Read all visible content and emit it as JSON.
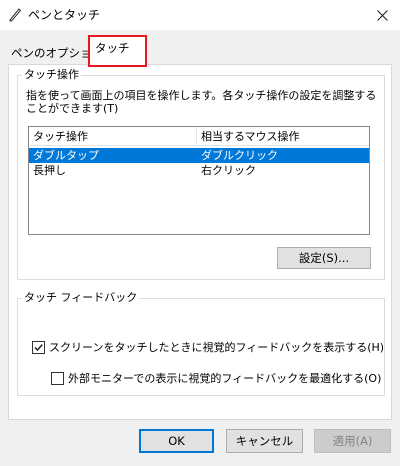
{
  "window": {
    "title": "ペンとタッチ",
    "icon": "pen-icon",
    "close_glyph": "×"
  },
  "tabs": [
    {
      "label": "ペンのオプション",
      "active": false
    },
    {
      "label": "タッチ",
      "active": true
    }
  ],
  "touch_actions": {
    "legend": "タッチ操作",
    "description_line1": "指を使って画面上の項目を操作します。各タッチ操作の設定を調整する",
    "description_line2": "ことができます(T)",
    "columns": [
      "タッチ操作",
      "相当するマウス操作"
    ],
    "rows": [
      {
        "action": "ダブルタップ",
        "mouse": "ダブルクリック",
        "selected": true
      },
      {
        "action": "長押し",
        "mouse": "右クリック",
        "selected": false
      }
    ],
    "settings_button": "設定(S)..."
  },
  "feedback": {
    "legend": "タッチ フィードバック",
    "show_visual_feedback": {
      "label": "スクリーンをタッチしたときに視覚的フィードバックを表示する(H)",
      "checked": true
    },
    "optimize_external": {
      "label": "外部モニターでの表示に視覚的フィードバックを最適化する(O)",
      "checked": false
    }
  },
  "buttons": {
    "ok": "OK",
    "cancel": "キャンセル",
    "apply": "適用(A)"
  },
  "colors": {
    "selection": "#0078d7",
    "tab_highlight": "#e8161e"
  }
}
